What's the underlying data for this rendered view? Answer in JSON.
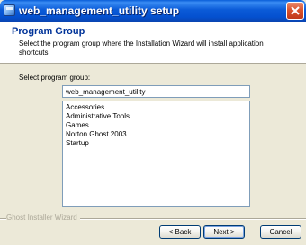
{
  "window": {
    "title": "web_management_utility setup"
  },
  "header": {
    "title": "Program Group",
    "description": "Select the program group where the Installation Wizard will install application shortcuts."
  },
  "form": {
    "label": "Select program group:",
    "input_value": "web_management_utility",
    "groups": [
      "Accessories",
      "Administrative Tools",
      "Games",
      "Norton Ghost 2003",
      "Startup"
    ]
  },
  "footer": {
    "brand": "Ghost Installer Wizard"
  },
  "buttons": {
    "back": "< Back",
    "next": "Next >",
    "cancel": "Cancel"
  },
  "colors": {
    "titlebar": "#0a5ed8",
    "header_title": "#003399",
    "close": "#d9532e",
    "window_bg": "#ece9d8"
  },
  "icons": {
    "app": "app-icon",
    "close": "close-icon"
  }
}
